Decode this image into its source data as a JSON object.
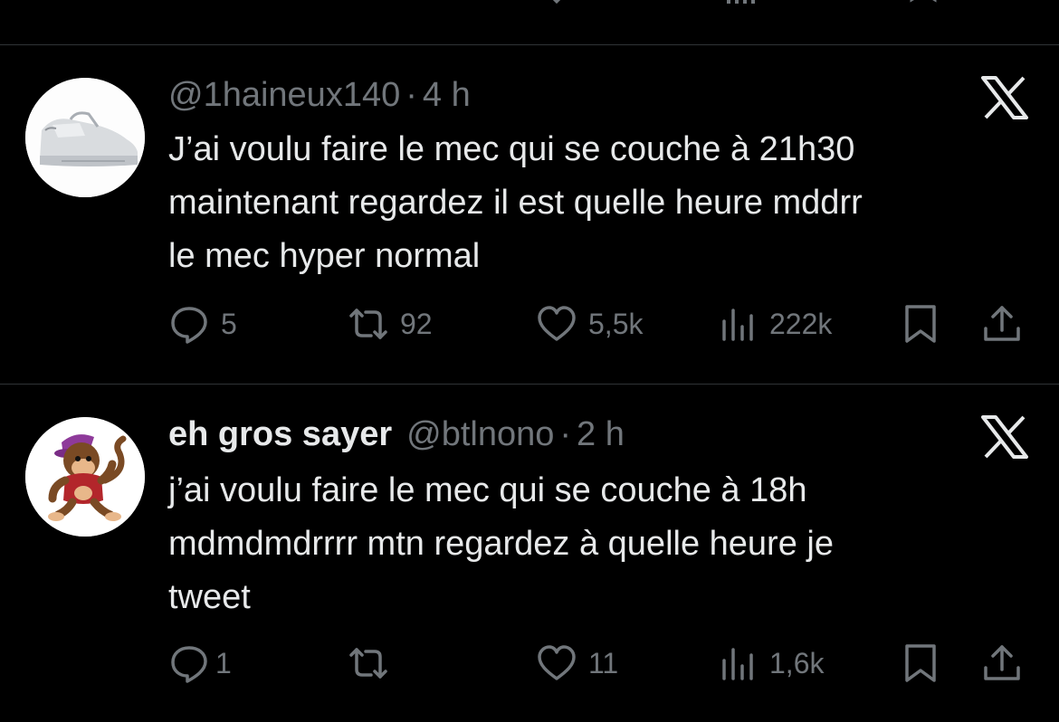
{
  "tweets": [
    {
      "name": "",
      "handle": "@1haineux140",
      "separator": "·",
      "time": "4 h",
      "lines": [
        "J’ai voulu faire le mec qui se couche à 21h30",
        "maintenant regardez il est quelle heure mddrr",
        "le mec hyper normal"
      ],
      "replies": "5",
      "reposts": "92",
      "likes": "5,5k",
      "views": "222k",
      "avatar_icon": "sneaker-avatar"
    },
    {
      "name": "eh gros sayer",
      "handle": "@btlnono",
      "separator": "·",
      "time": "2 h",
      "lines": [
        "j’ai voulu faire le mec qui se couche à 18h",
        "mdmdmdrrrr mtn regardez à quelle heure je",
        "tweet"
      ],
      "replies": "1",
      "reposts": "",
      "likes": "11",
      "views": "1,6k",
      "avatar_icon": "monkey-avatar"
    }
  ],
  "colors": {
    "background": "#000000",
    "text": "#e7e9ea",
    "muted": "#71767b",
    "divider": "#2f3336"
  },
  "icons": [
    "reply-icon",
    "repost-icon",
    "like-icon",
    "views-icon",
    "bookmark-icon",
    "share-icon",
    "x-logo-icon"
  ]
}
